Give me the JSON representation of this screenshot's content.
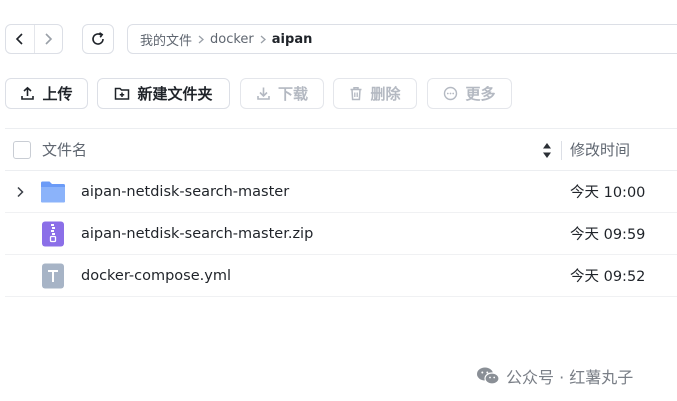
{
  "breadcrumb": [
    "我的文件",
    "docker",
    "aipan"
  ],
  "toolbar": {
    "upload": "上传",
    "new_folder": "新建文件夹",
    "download": "下载",
    "delete": "删除",
    "more": "更多"
  },
  "table": {
    "col_name": "文件名",
    "col_time": "修改时间",
    "rows": [
      {
        "name": "aipan-netdisk-search-master",
        "time": "今天 10:00",
        "type": "folder-icon"
      },
      {
        "name": "aipan-netdisk-search-master.zip",
        "time": "今天 09:59",
        "type": "zip-icon"
      },
      {
        "name": "docker-compose.yml",
        "time": "今天 09:52",
        "type": "text-file-icon"
      }
    ]
  },
  "watermark": "公众号 · 红薯丸子",
  "colors": {
    "folder": "#6b9bf7",
    "zip": "#8b6fe8",
    "text_file": "#a7b4c6",
    "disabled": "#b4b9c2",
    "border": "#dcdfe6"
  }
}
